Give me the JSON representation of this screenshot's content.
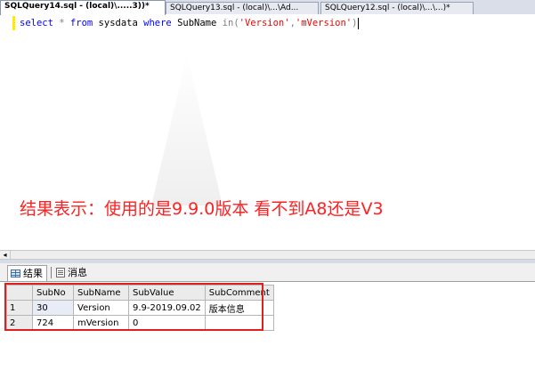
{
  "tabs": [
    {
      "label": "SQLQuery14.sql - (local)\\.....3))*",
      "active": true
    },
    {
      "label": "SQLQuery13.sql - (local)\\...\\Ad...",
      "active": false
    },
    {
      "label": "SQLQuery12.sql - (local)\\...\\...)*",
      "active": false
    }
  ],
  "editor": {
    "tok_select": "select",
    "tok_star": "*",
    "tok_from": "from",
    "tok_table": "sysdata",
    "tok_where": "where",
    "tok_col": "SubName",
    "tok_in": "in",
    "tok_open": "(",
    "tok_v1": "'Version'",
    "tok_comma": ",",
    "tok_v2": "'mVersion'",
    "tok_close": ")"
  },
  "annotation": "结果表示：使用的是9.9.0版本  看不到A8还是V3",
  "scrollbar": {
    "left_arrow": "◂"
  },
  "results_tabs": {
    "results_label": "结果",
    "messages_label": "消息"
  },
  "grid": {
    "headers": [
      "SubNo",
      "SubName",
      "SubValue",
      "SubComment"
    ],
    "rows": [
      {
        "num": "1",
        "SubNo": "30",
        "SubName": "Version",
        "SubValue": "9.9-2019.09.02",
        "SubComment": "版本信息"
      },
      {
        "num": "2",
        "SubNo": "724",
        "SubName": "mVersion",
        "SubValue": "0",
        "SubComment": ""
      }
    ]
  },
  "colors": {
    "annotation": "#ff2121",
    "highlight_box": "#e01f1f",
    "keyword": "#0000ff",
    "string": "#ff0000"
  }
}
